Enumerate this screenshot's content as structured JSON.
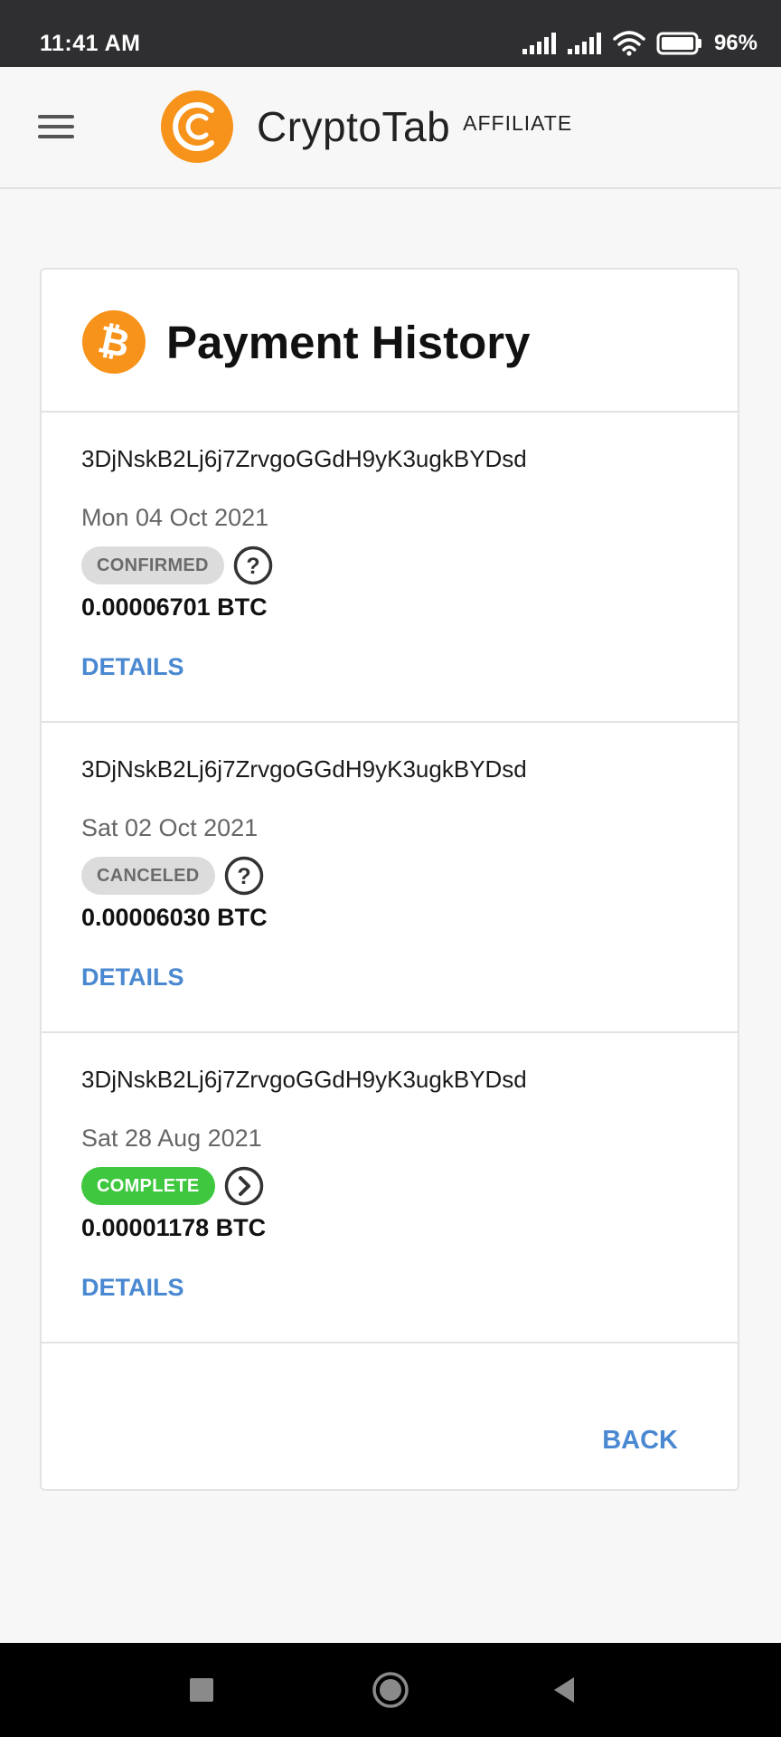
{
  "status_bar": {
    "time": "11:41 AM",
    "battery_percent": "96%",
    "icons": [
      "signal-icon",
      "signal-icon",
      "wifi-icon",
      "battery-icon"
    ]
  },
  "header": {
    "app_name": "CryptoTab",
    "app_suffix": "AFFILIATE",
    "menu_icon": "hamburger-menu-icon",
    "brand_color": "#f7931a"
  },
  "card": {
    "title": "Payment History",
    "title_icon": "bitcoin-icon",
    "payments": [
      {
        "address": "3DjNskB2Lj6j7ZrvgoGGdH9yK3ugkBYDsd",
        "date": "Mon 04 Oct 2021",
        "status": "CONFIRMED",
        "status_color": "#dcdcdc",
        "status_icon": "question-circle-icon",
        "amount": "0.00006701 BTC",
        "details_label": "DETAILS"
      },
      {
        "address": "3DjNskB2Lj6j7ZrvgoGGdH9yK3ugkBYDsd",
        "date": "Sat 02 Oct 2021",
        "status": "CANCELED",
        "status_color": "#dcdcdc",
        "status_icon": "question-circle-icon",
        "amount": "0.00006030 BTC",
        "details_label": "DETAILS"
      },
      {
        "address": "3DjNskB2Lj6j7ZrvgoGGdH9yK3ugkBYDsd",
        "date": "Sat 28 Aug 2021",
        "status": "COMPLETE",
        "status_color": "#3fc83f",
        "status_icon": "chevron-right-circle-icon",
        "amount": "0.00001178 BTC",
        "details_label": "DETAILS"
      }
    ],
    "back_label": "BACK",
    "link_color": "#4a89d1"
  },
  "nav_bar": {
    "buttons": [
      "recent-apps-icon",
      "home-icon",
      "back-icon"
    ]
  }
}
